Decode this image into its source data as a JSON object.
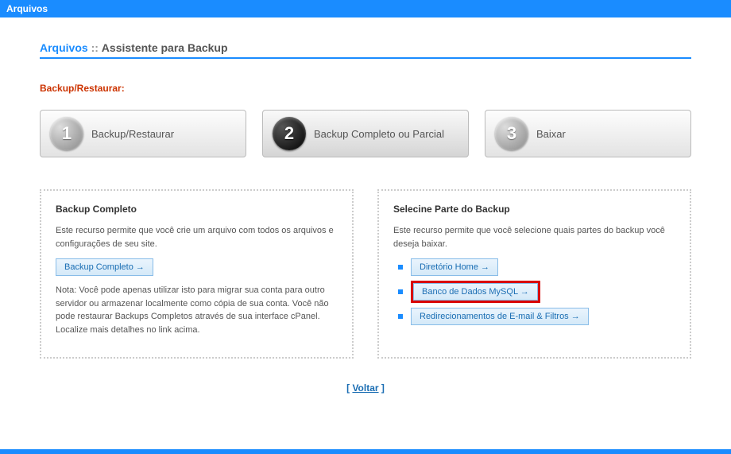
{
  "topbar": {
    "title": "Arquivos"
  },
  "breadcrumb": {
    "main": "Arquivos",
    "sep": "::",
    "sub": "Assistente para Backup"
  },
  "section": {
    "title": "Backup/Restaurar:"
  },
  "steps": {
    "s1": {
      "num": "1",
      "label": "Backup/Restaurar"
    },
    "s2": {
      "num": "2",
      "label": "Backup Completo ou Parcial"
    },
    "s3": {
      "num": "3",
      "label": "Baixar"
    }
  },
  "panel_left": {
    "title": "Backup Completo",
    "desc": "Este recurso permite que você crie um arquivo com todos os arquivos e configurações de seu site.",
    "button": "Backup Completo →",
    "note": "Nota: Você pode apenas utilizar isto para migrar sua conta para outro servidor ou armazenar localmente como cópia de sua conta. Você não pode restaurar Backups Completos através de sua interface cPanel. Localize mais detalhes no link acima."
  },
  "panel_right": {
    "title": "Selecine Parte do Backup",
    "desc": "Este recurso permite que você selecione quais partes do backup você deseja baixar.",
    "items": {
      "home": "Diretório Home →",
      "mysql": "Banco de Dados MySQL →",
      "email": "Redirecionamentos de E-mail & Filtros →"
    }
  },
  "back": {
    "bracket_open": "[ ",
    "label": "Voltar",
    "bracket_close": " ]"
  }
}
